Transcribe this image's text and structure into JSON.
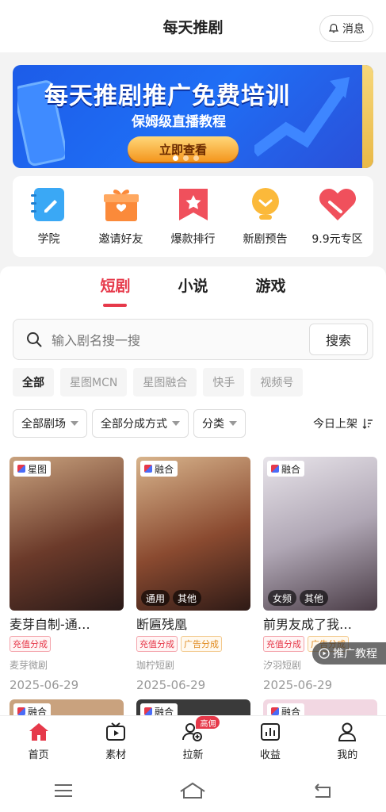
{
  "header": {
    "title": "每天推剧",
    "msg_label": "消息"
  },
  "banner": {
    "title": "每天推剧推广免费培训",
    "subtitle": "保姆级直播教程",
    "button": "立即查看"
  },
  "quick_links": [
    {
      "label": "学院",
      "icon": "notebook-icon"
    },
    {
      "label": "邀请好友",
      "icon": "gift-icon"
    },
    {
      "label": "爆款排行",
      "icon": "star-bookmark-icon"
    },
    {
      "label": "新剧预告",
      "icon": "lightbulb-icon"
    },
    {
      "label": "9.9元专区",
      "icon": "heart-icon"
    }
  ],
  "tabs": [
    {
      "label": "短剧"
    },
    {
      "label": "小说"
    },
    {
      "label": "游戏"
    }
  ],
  "search": {
    "placeholder": "输入剧名搜一搜",
    "button": "搜索"
  },
  "filters": [
    "全部",
    "星图MCN",
    "星图融合",
    "快手",
    "视频号"
  ],
  "dropdowns": {
    "theater": "全部剧场",
    "method": "全部分成方式",
    "category": "分类",
    "sort": "今日上架"
  },
  "cards": [
    {
      "badge": "星图",
      "tags": [],
      "title": "麦芽自制-通…",
      "tag1": "充值分成",
      "tag2": "",
      "studio": "麦芽微剧",
      "date": "2025-06-29"
    },
    {
      "badge": "融合",
      "tags": [
        "通用",
        "其他"
      ],
      "title": "断匾残凰",
      "tag1": "充值分成",
      "tag2": "广告分成",
      "studio": "珈柠短剧",
      "date": "2025-06-29"
    },
    {
      "badge": "融合",
      "tags": [
        "女频",
        "其他"
      ],
      "title": "前男友成了我…",
      "tag1": "充值分成",
      "tag2": "广告分成",
      "studio": "汐羽短剧",
      "date": "2025-06-29"
    }
  ],
  "row2_badges": [
    "融合",
    "融合",
    "融合"
  ],
  "float_button": "推广教程",
  "bottom_nav": [
    {
      "label": "首页",
      "icon": "home-icon"
    },
    {
      "label": "素材",
      "icon": "tv-icon"
    },
    {
      "label": "拉新",
      "icon": "add-user-icon",
      "badge": "高佣"
    },
    {
      "label": "收益",
      "icon": "bar-chart-icon"
    },
    {
      "label": "我的",
      "icon": "person-icon"
    }
  ],
  "colors": {
    "accent": "#e6394a",
    "banner": "#1f6ef5"
  }
}
